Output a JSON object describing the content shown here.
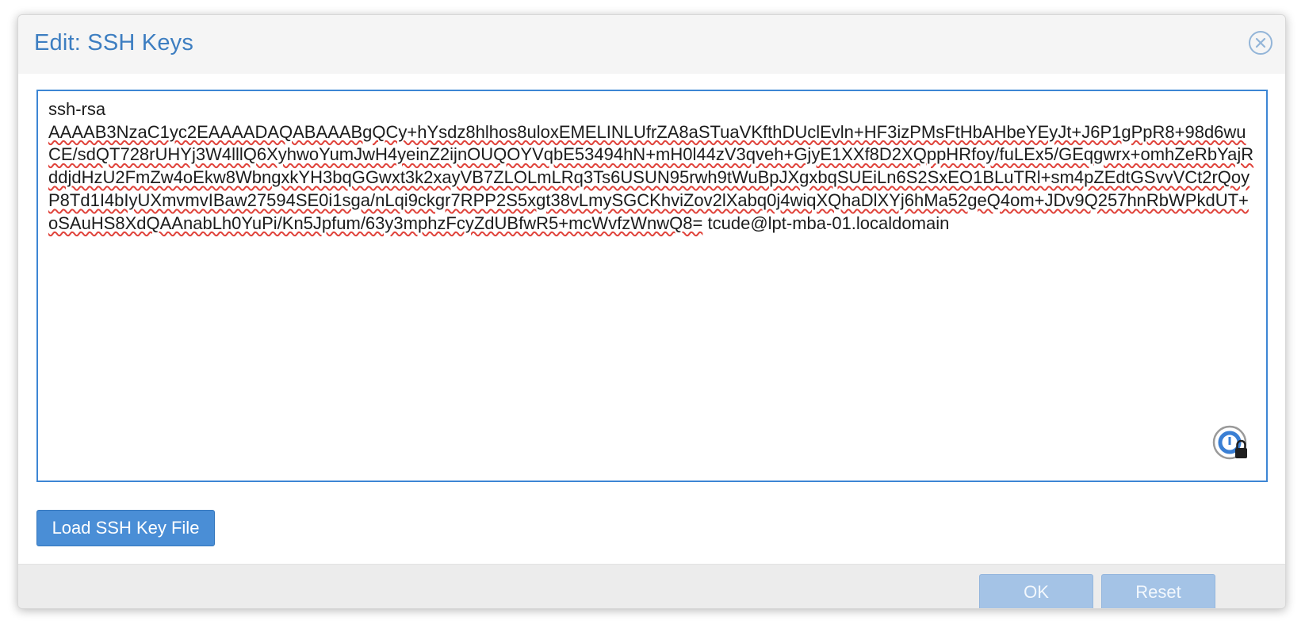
{
  "dialog": {
    "title": "Edit: SSH Keys",
    "close_icon": "close-circle-icon"
  },
  "ssh_key": {
    "prefix": "ssh-rsa",
    "key_body": "AAAAB3NzaC1yc2EAAAADAQABAAABgQCy+hYsdz8hlhos8uloxEMELINLUfrZA8aSTuaVKfthDUclEvln+HF3izPMsFtHbAHbeYEyJt+J6P1gPpR8+98d6wuCE/sdQT728rUHYj3W4lllQ6XyhwoYumJwH4yeinZ2ijnOUQOYVqbE53494hN+mH0l44zV3qveh+GjyE1XXf8D2XQppHRfoy/fuLEx5/GEqgwrx+omhZeRbYajRddjdHzU2FmZw4oEkw8WbngxkYH3bqGGwxt3k2xayVB7ZLOLmLRq3Ts6USUN95rwh9tWuBpJXgxbqSUEiLn6S2SxEO1BLuTRl+sm4pZEdtGSvvVCt2rQoyP8Td1I4bIyUXmvmvIBaw27594SE0i1sga/nLqi9ckgr7RPP2S5xgt38vLmySGCKhviZov2lXabq0j4wiqXQhaDlXYj6hMa52geQ4om+JDv9Q257hnRbWPkdUT+oSAuHS8XdQAAnabLh0YuPi/Kn5Jpfum/63y3mphzFcyZdUBfwR5+mcWvfzWnwQ8=",
    "comment": "tcude@lpt-mba-01.localdomain",
    "password_manager_icon": "password-manager-lock-icon"
  },
  "buttons": {
    "load_file": "Load SSH Key File",
    "ok": "OK",
    "reset": "Reset"
  },
  "colors": {
    "title": "#3d7ec1",
    "primary_button": "#4a8ed6",
    "disabled_button": "#a4c3e6",
    "focus_border": "#3d86d4",
    "spellcheck": "#e0433b"
  }
}
